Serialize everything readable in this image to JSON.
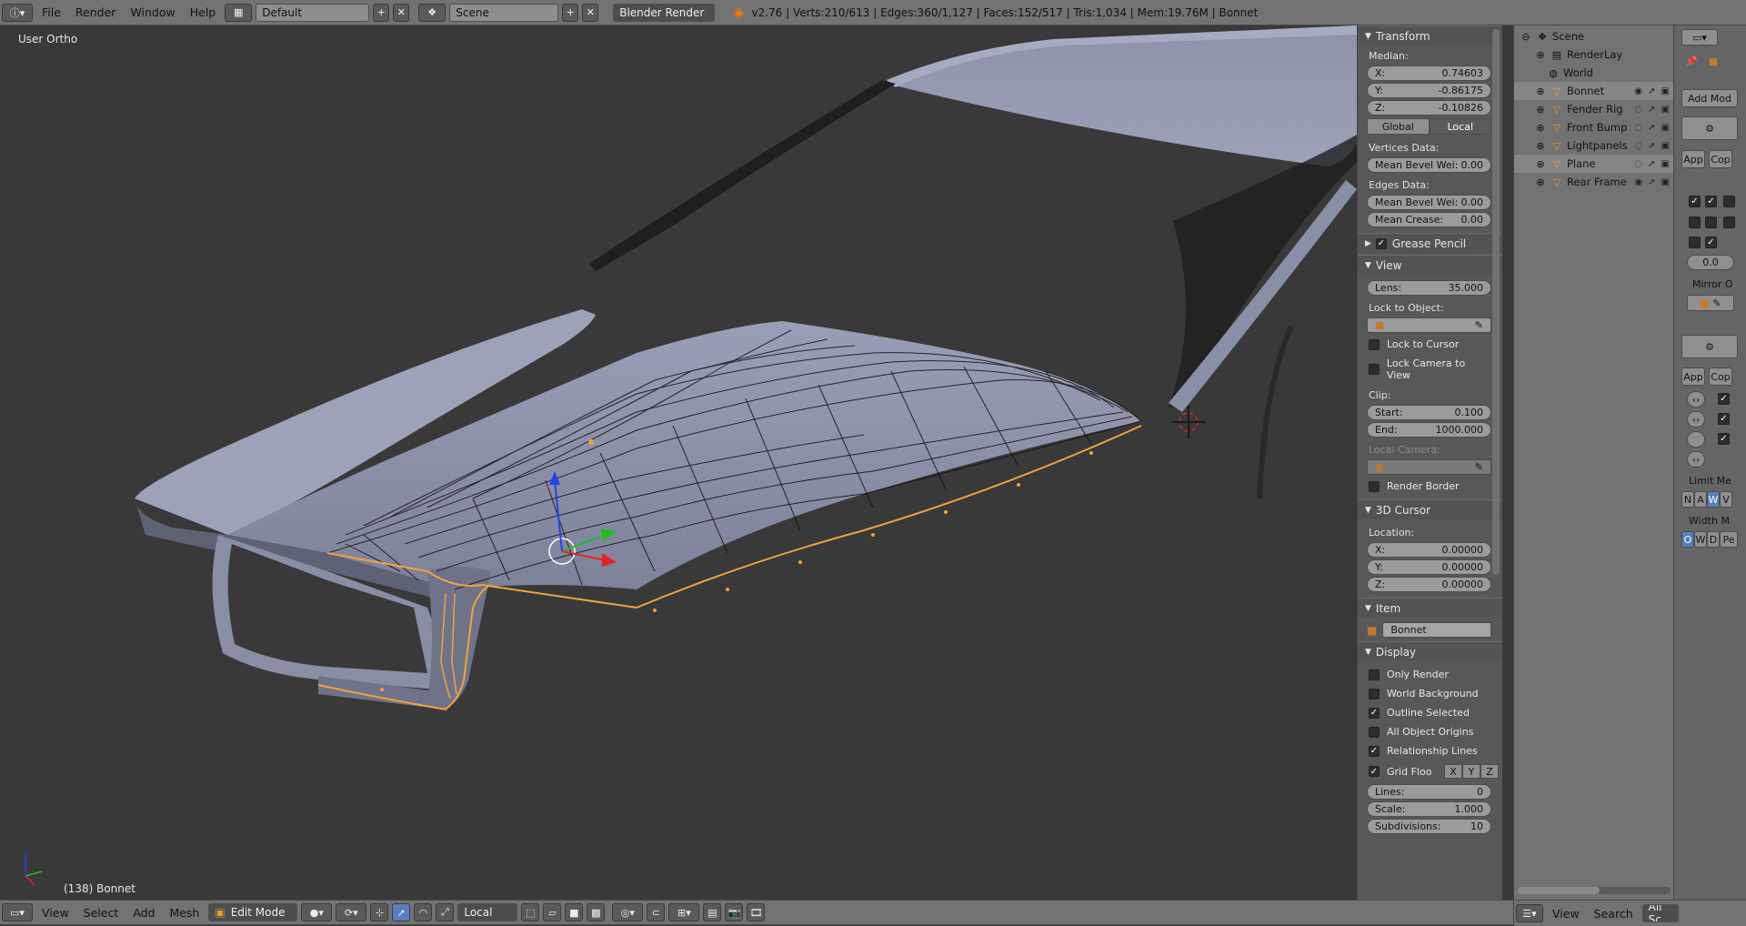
{
  "topbar": {
    "menus": [
      "File",
      "Render",
      "Window",
      "Help"
    ],
    "layout": "Default",
    "scene": "Scene",
    "engine": "Blender Render",
    "info": "v2.76 | Verts:210/613 | Edges:360/1,127 | Faces:152/517 | Tris:1,034 | Mem:19.76M | Bonnet"
  },
  "viewport": {
    "label": "User Ortho",
    "status": "(138) Bonnet"
  },
  "npanel": {
    "transform": {
      "title": "Transform",
      "median": "Median:",
      "x_label": "X:",
      "x": "0.74603",
      "y_label": "Y:",
      "y": "-0.86175",
      "z_label": "Z:",
      "z": "-0.10826",
      "global": "Global",
      "local": "Local",
      "vdata": "Vertices Data:",
      "vbevel_label": "Mean Bevel Wei:",
      "vbevel": "0.00",
      "edata": "Edges Data:",
      "ebevel_label": "Mean Bevel Wei:",
      "ebevel": "0.00",
      "crease_label": "Mean Crease:",
      "crease": "0.00"
    },
    "grease": {
      "title": "Grease Pencil"
    },
    "view": {
      "title": "View",
      "lens_label": "Lens:",
      "lens": "35.000",
      "lock_obj": "Lock to Object:",
      "lock_cursor": "Lock to Cursor",
      "lock_cam": "Lock Camera to View",
      "clip": "Clip:",
      "start_label": "Start:",
      "start": "0.100",
      "end_label": "End:",
      "end": "1000.000",
      "local_cam": "Local Camera:",
      "render_border": "Render Border"
    },
    "cursor": {
      "title": "3D Cursor",
      "location": "Location:",
      "x_label": "X:",
      "x": "0.00000",
      "y_label": "Y:",
      "y": "0.00000",
      "z_label": "Z:",
      "z": "0.00000"
    },
    "item": {
      "title": "Item",
      "name": "Bonnet"
    },
    "display": {
      "title": "Display",
      "only_render": "Only Render",
      "world_bg": "World Background",
      "outline_sel": "Outline Selected",
      "all_origins": "All Object Origins",
      "rel_lines": "Relationship Lines",
      "grid_floor": "Grid Floo",
      "x": "X",
      "y": "Y",
      "z": "Z",
      "lines_label": "Lines:",
      "lines": "0",
      "scale_label": "Scale:",
      "scale": "1.000",
      "subdiv_label": "Subdivisions:",
      "subdiv": "10"
    }
  },
  "outliner": {
    "items": [
      "Scene",
      "RenderLay",
      "World",
      "Bonnet",
      "Fender Rig",
      "Front Bump",
      "Lightpanels",
      "Plane",
      "Rear Frame"
    ],
    "view": "View",
    "search": "Search",
    "all": "All Sc"
  },
  "props": {
    "add_mod": "Add Mod",
    "apply": "App",
    "copy": "Cop",
    "value": "0.0",
    "mirror": "Mirror O",
    "limit": "Limit Me",
    "width": "Width M",
    "n": "N",
    "a": "A",
    "w": "W",
    "v": "V",
    "o": "O",
    "wd": "W",
    "d": "D",
    "pe": "Pe"
  },
  "bottombar": {
    "menus": [
      "View",
      "Select",
      "Add",
      "Mesh"
    ],
    "mode": "Edit Mode",
    "orientation": "Local"
  },
  "colors": {
    "selected_edge": "#f2a23a",
    "mesh": "#8a8fa8",
    "bg": "#393939"
  }
}
